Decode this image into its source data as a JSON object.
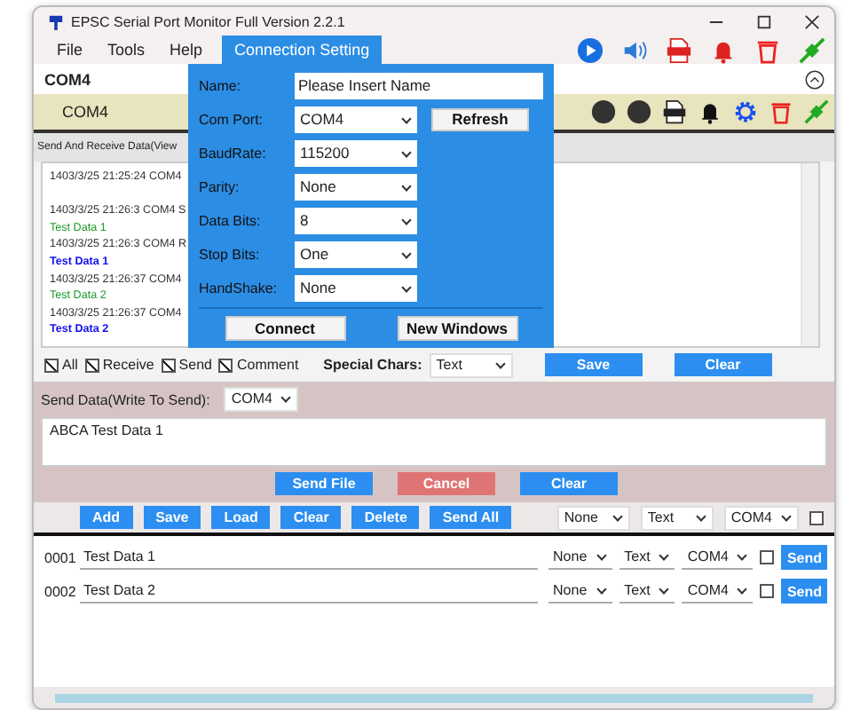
{
  "window": {
    "title": "EPSC Serial Port Monitor Full Version 2.2.1"
  },
  "menu": [
    {
      "label": "File",
      "selected": false
    },
    {
      "label": "Tools",
      "selected": false
    },
    {
      "label": "Help",
      "selected": false
    },
    {
      "label": "Connection Setting",
      "selected": true
    }
  ],
  "port_title": "COM4",
  "port_tab": {
    "label": "COM4"
  },
  "log": {
    "title": "Send And Receive Data(View",
    "lines": [
      {
        "kind": "header",
        "text": "1403/3/25 21:25:24 COM4"
      },
      {
        "kind": "header",
        "text": "1403/3/25 21:26:3 COM4 S"
      },
      {
        "kind": "sent",
        "text": "Test Data 1"
      },
      {
        "kind": "header",
        "text": "1403/3/25 21:26:3 COM4 R"
      },
      {
        "kind": "received",
        "text": "Test Data 1"
      },
      {
        "kind": "header",
        "text": "1403/3/25 21:26:37 COM4"
      },
      {
        "kind": "sent",
        "text": "Test Data 2"
      },
      {
        "kind": "header",
        "text": "1403/3/25 21:26:37 COM4"
      },
      {
        "kind": "received",
        "text": "Test Data 2"
      }
    ]
  },
  "filters": [
    {
      "label": "All",
      "checked": true
    },
    {
      "label": "Receive",
      "checked": true
    },
    {
      "label": "Send",
      "checked": true
    },
    {
      "label": "Comment",
      "checked": true
    }
  ],
  "special_chars": {
    "label": "Special Chars:",
    "value": "Text"
  },
  "log_buttons": [
    "Save",
    "Clear"
  ],
  "send": {
    "label": "Send Data(Write To Send):",
    "port": "COM4",
    "value": "ABCA Test Data 1",
    "buttons": [
      {
        "kind": "send-file",
        "label": "Send File"
      },
      {
        "kind": "cancel",
        "label": "Cancel"
      },
      {
        "kind": "clear",
        "label": "Clear"
      }
    ]
  },
  "list_toolbar": {
    "buttons": [
      "Add",
      "Save",
      "Load",
      "Clear",
      "Delete",
      "Send All"
    ],
    "selects": [
      "None",
      "Text",
      "COM4"
    ],
    "checked": false
  },
  "rows": [
    {
      "index": "0001",
      "value": "Test Data 1",
      "selects": [
        "None",
        "Text",
        "COM4"
      ],
      "checked": false,
      "button": "Send"
    },
    {
      "index": "0002",
      "value": "Test Data 2",
      "selects": [
        "None",
        "Text",
        "COM4"
      ],
      "checked": false,
      "button": "Send"
    }
  ],
  "connection": {
    "fields": [
      {
        "kind": "input",
        "label": "Name:",
        "value": "Please Insert Name"
      },
      {
        "kind": "select",
        "label": "Com Port:",
        "value": "COM4",
        "button": "Refresh"
      },
      {
        "kind": "select",
        "label": "BaudRate:",
        "value": "115200"
      },
      {
        "kind": "select",
        "label": "Parity:",
        "value": "None"
      },
      {
        "kind": "select",
        "label": "Data Bits:",
        "value": "8"
      },
      {
        "kind": "select",
        "label": "Stop Bits:",
        "value": "One"
      },
      {
        "kind": "select",
        "label": "HandShake:",
        "value": "None"
      }
    ],
    "buttons": [
      "Connect",
      "New Windows"
    ]
  }
}
